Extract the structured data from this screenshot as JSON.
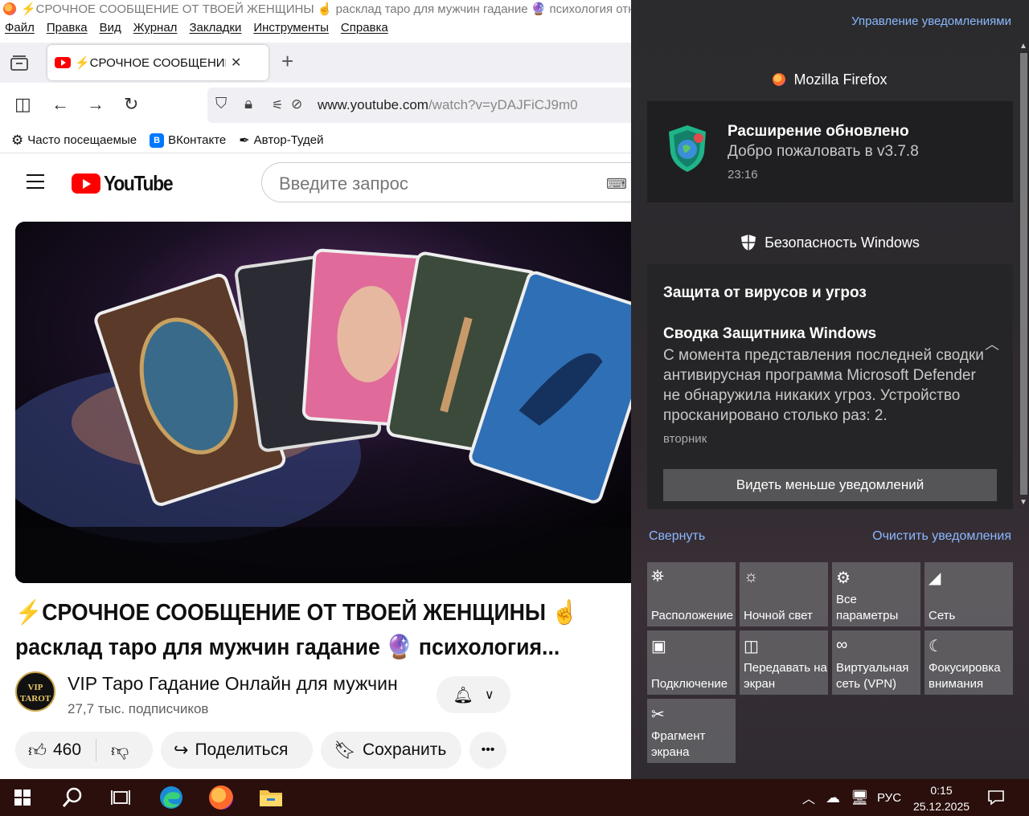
{
  "window": {
    "title": "⚡СРОЧНОЕ СООБЩЕНИЕ ОТ ТВОЕЙ ЖЕНЩИНЫ ☝ расклад таро для мужчин гадание 🔮 психология отнош"
  },
  "menubar": [
    "Файл",
    "Правка",
    "Вид",
    "Журнал",
    "Закладки",
    "Инструменты",
    "Справка"
  ],
  "tab": {
    "title": "⚡СРОЧНОЕ СООБЩЕНИЕ ОТ ТВОЕЙ ЖЕНЩИНЫ",
    "close": "✕",
    "new": "+"
  },
  "urlbar": {
    "domain": "www.youtube.com",
    "path": "/watch?v=yDAJFiCJ9m0"
  },
  "bookmarks": [
    {
      "label": "Часто посещаемые",
      "icon": "gear-icon"
    },
    {
      "label": "ВКонтакте",
      "icon": "vk-icon"
    },
    {
      "label": "Автор-Тудей",
      "icon": "pen-icon"
    }
  ],
  "youtube": {
    "logo": "YouTube",
    "search_placeholder": "Введите запрос",
    "video_title_line1": "⚡СРОЧНОЕ СООБЩЕНИЕ ОТ ТВОЕЙ ЖЕНЩИНЫ ☝",
    "video_title_line2": "расклад таро для мужчин гадание 🔮 психология...",
    "avatar_text": "VIP TAROT",
    "channel": "VIP Таро Гадание Онлайн для мужчин",
    "subscribers": "27,7 тыс. подписчиков",
    "likes": "460",
    "share": "Поделиться",
    "save": "Сохранить",
    "more": "•••"
  },
  "action_center": {
    "manage": "Управление уведомлениями",
    "firefox_header": "Mozilla Firefox",
    "firefox_notif": {
      "title": "Расширение обновлено",
      "body": "Добро пожаловать в v3.7.8",
      "time": "23:16"
    },
    "security_header": "Безопасность Windows",
    "security_notif": {
      "heading": "Защита от вирусов и угроз",
      "title": "Сводка Защитника Windows",
      "body": "С момента представления последней сводки антивирусная программа Microsoft Defender не обнаружила никаких угроз. Устройство просканировано столько раз: 2.",
      "day": "вторник",
      "button": "Видеть меньше уведомлений"
    },
    "collapse": "Свернуть",
    "clear": "Очистить уведомления",
    "quick_actions": [
      {
        "label": "Расположение",
        "icon": "location-icon",
        "glyph": "⛯"
      },
      {
        "label": "Ночной свет",
        "icon": "night-light-icon",
        "glyph": "☼"
      },
      {
        "label": "Все параметры",
        "icon": "settings-icon",
        "glyph": "⚙"
      },
      {
        "label": "Сеть",
        "icon": "network-icon",
        "glyph": "◢"
      },
      {
        "label": "Подключение",
        "icon": "connect-icon",
        "glyph": "▣"
      },
      {
        "label": "Передавать на экран",
        "icon": "project-icon",
        "glyph": "◫"
      },
      {
        "label": "Виртуальная сеть (VPN)",
        "icon": "vpn-icon",
        "glyph": "∞"
      },
      {
        "label": "Фокусировка внимания",
        "icon": "focus-icon",
        "glyph": "☾"
      },
      {
        "label": "Фрагмент экрана",
        "icon": "snip-icon",
        "glyph": "✂"
      }
    ]
  },
  "taskbar": {
    "language": "РУС",
    "time": "0:15",
    "date": "25.12.2025"
  },
  "colors": {
    "accent_link": "#8ab8ff",
    "youtube_red": "#ff0000",
    "taskbar": "#2a0f0d"
  }
}
